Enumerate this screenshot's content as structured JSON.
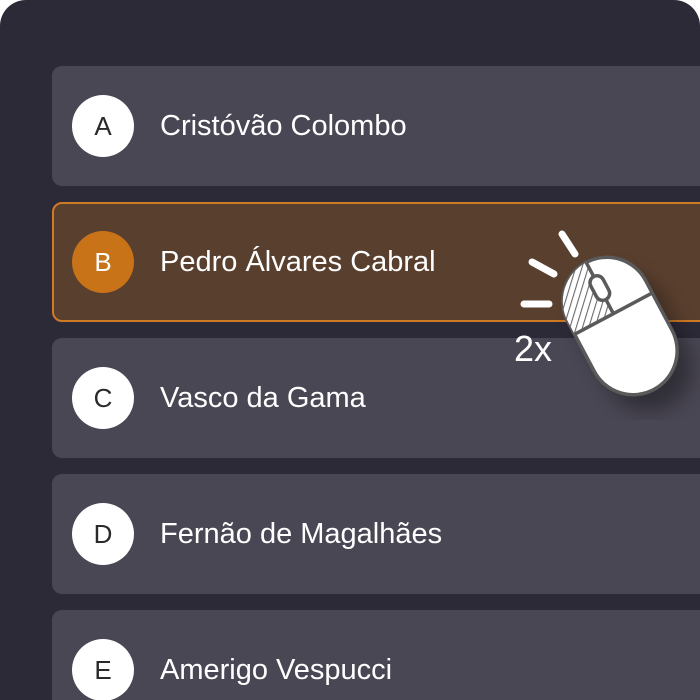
{
  "options": [
    {
      "letter": "A",
      "label": "Cristóvão Colombo"
    },
    {
      "letter": "B",
      "label": "Pedro Álvares Cabral"
    },
    {
      "letter": "C",
      "label": "Vasco da Gama"
    },
    {
      "letter": "D",
      "label": "Fernão de Magalhães"
    },
    {
      "letter": "E",
      "label": "Amerigo Vespucci"
    }
  ],
  "selected_option": "B",
  "hint": {
    "text": "2x",
    "icon": "mouse-double-click-icon"
  },
  "colors": {
    "background": "#2d2a37",
    "option": "#4a4754",
    "selected_option": "#593f2e",
    "accent": "#cf7a24"
  }
}
